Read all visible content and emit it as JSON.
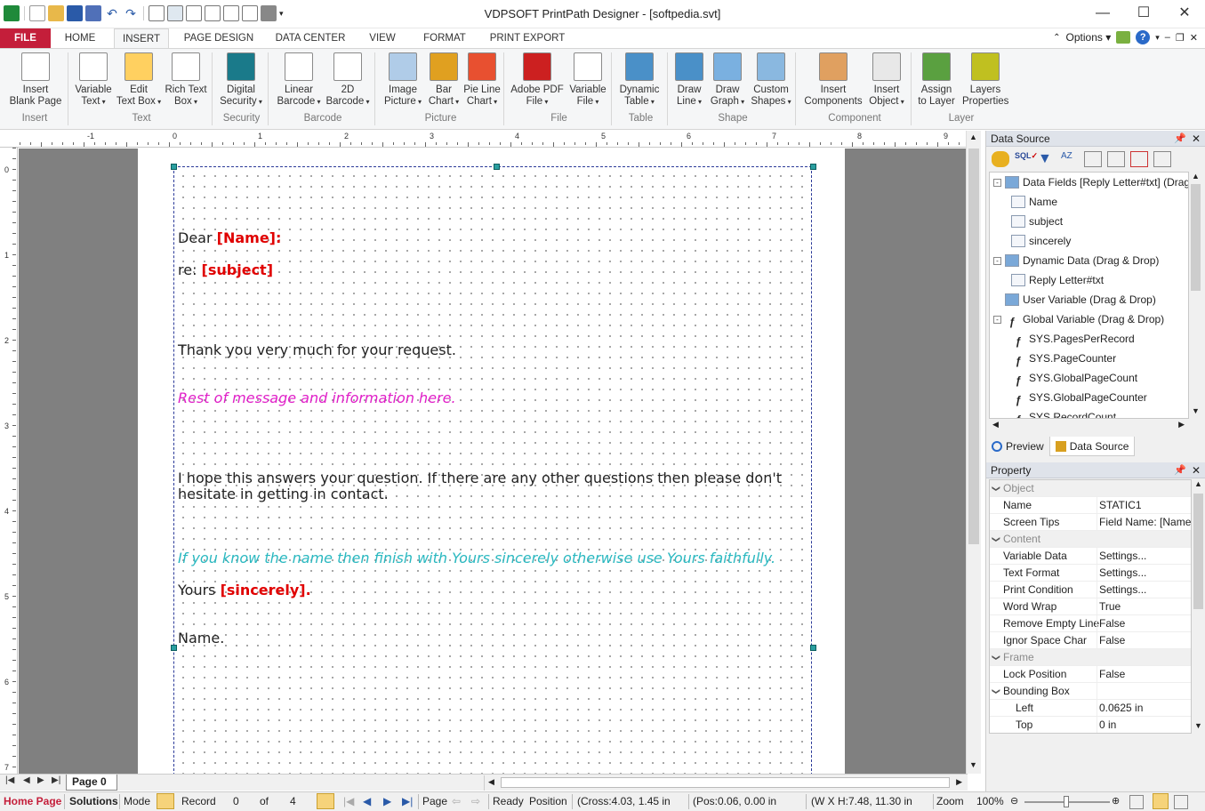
{
  "window": {
    "title": "VDPSOFT PrintPath Designer - [softpedia.svt]"
  },
  "tabs": [
    "FILE",
    "HOME",
    "INSERT",
    "PAGE DESIGN",
    "DATA CENTER",
    "VIEW",
    "FORMAT",
    "PRINT EXPORT"
  ],
  "options_label": "Options",
  "ribbon": {
    "buttons": [
      {
        "l1": "Insert",
        "l2": "Blank Page",
        "icon": "blank-page-icon"
      },
      {
        "l1": "Variable",
        "l2": "Text",
        "icon": "variable-text-icon"
      },
      {
        "l1": "Edit",
        "l2": "Text Box",
        "icon": "edit-textbox-icon"
      },
      {
        "l1": "Rich Text",
        "l2": "Box",
        "icon": "rich-text-icon"
      },
      {
        "l1": "Digital",
        "l2": "Security",
        "icon": "shield-icon"
      },
      {
        "l1": "Linear",
        "l2": "Barcode",
        "icon": "barcode-icon"
      },
      {
        "l1": "2D",
        "l2": "Barcode",
        "icon": "qr-code-icon"
      },
      {
        "l1": "Image",
        "l2": "Picture",
        "icon": "image-icon"
      },
      {
        "l1": "Bar",
        "l2": "Chart",
        "icon": "bar-chart-icon"
      },
      {
        "l1": "Pie Line",
        "l2": "Chart",
        "icon": "pie-chart-icon"
      },
      {
        "l1": "Adobe PDF",
        "l2": "File",
        "icon": "pdf-icon"
      },
      {
        "l1": "Variable",
        "l2": "File",
        "icon": "variable-file-icon"
      },
      {
        "l1": "Dynamic",
        "l2": "Table",
        "icon": "table-icon"
      },
      {
        "l1": "Draw",
        "l2": "Line",
        "icon": "line-icon"
      },
      {
        "l1": "Draw",
        "l2": "Graph",
        "icon": "rectangle-icon"
      },
      {
        "l1": "Custom",
        "l2": "Shapes",
        "icon": "shapes-icon"
      },
      {
        "l1": "Insert",
        "l2": "Components",
        "icon": "components-icon"
      },
      {
        "l1": "Insert",
        "l2": "Object",
        "icon": "object-icon"
      },
      {
        "l1": "Assign",
        "l2": "to Layer",
        "icon": "assign-layer-icon"
      },
      {
        "l1": "Layers",
        "l2": "Properties",
        "icon": "layers-icon"
      }
    ],
    "groups": [
      "Insert",
      "Text",
      "Security",
      "Barcode",
      "Picture",
      "File",
      "Table",
      "Shape",
      "Component",
      "Layer"
    ]
  },
  "ruler": {
    "h_numbers": [
      "-1",
      "0",
      "1",
      "2",
      "3",
      "4",
      "5",
      "6",
      "7",
      "8",
      "9"
    ],
    "v_numbers": [
      "0",
      "1",
      "2",
      "3",
      "4",
      "5",
      "6",
      "7"
    ]
  },
  "document": {
    "line1_prefix": "Dear ",
    "line1_field": "[Name]:",
    "line2_prefix": "re:  ",
    "line2_field": "[subject]",
    "line3": "Thank you very much for your request.",
    "line4": "Rest of message and information here.",
    "line5a": "I hope this answers your question.  If there are any other questions then please don't",
    "line5b": "hesitate in getting in contact.",
    "line6": "If you know the name then finish with Yours sincerely otherwise use Yours faithfully.",
    "line7_prefix": "Yours ",
    "line7_field": "[sincerely].",
    "line8": "Name.",
    "colors": {
      "field": "#e00000",
      "magenta": "#e020c8",
      "cyan": "#2ab8c0"
    }
  },
  "page_tab": "Page 0",
  "data_source": {
    "title": "Data Source",
    "tree": [
      {
        "label": "Data Fields [Reply Letter#txt]  (Drag",
        "level": 0,
        "expand": "-"
      },
      {
        "label": "Name",
        "level": 1
      },
      {
        "label": "subject",
        "level": 1
      },
      {
        "label": "sincerely",
        "level": 1
      },
      {
        "label": "Dynamic Data (Drag & Drop)",
        "level": 0,
        "expand": "-"
      },
      {
        "label": "Reply Letter#txt",
        "level": 1
      },
      {
        "label": "User Variable (Drag & Drop)",
        "level": 0
      },
      {
        "label": "Global Variable (Drag & Drop)",
        "level": 0,
        "expand": "-"
      },
      {
        "label": "SYS.PagesPerRecord",
        "level": 1
      },
      {
        "label": "SYS.PageCounter",
        "level": 1
      },
      {
        "label": "SYS.GlobalPageCount",
        "level": 1
      },
      {
        "label": "SYS.GlobalPageCounter",
        "level": 1
      },
      {
        "label": "SYS.RecordCount",
        "level": 1
      }
    ],
    "bottom_tabs": [
      "Preview",
      "Data Source"
    ]
  },
  "property": {
    "title": "Property",
    "rows": [
      {
        "k": "Object",
        "v": "",
        "cat": true
      },
      {
        "k": "Name",
        "v": "STATIC1"
      },
      {
        "k": "Screen Tips",
        "v": "Field Name: [Name"
      },
      {
        "k": "Content",
        "v": "",
        "cat": true
      },
      {
        "k": "Variable Data",
        "v": "Settings..."
      },
      {
        "k": "Text Format",
        "v": "Settings..."
      },
      {
        "k": "Print Condition",
        "v": "Settings..."
      },
      {
        "k": "Word Wrap",
        "v": "True"
      },
      {
        "k": "Remove Empty Line",
        "v": "False"
      },
      {
        "k": "Ignor Space Char",
        "v": "False"
      },
      {
        "k": "Frame",
        "v": "",
        "cat": true
      },
      {
        "k": "Lock Position",
        "v": "False"
      },
      {
        "k": "Bounding Box",
        "v": "",
        "sub": true
      },
      {
        "k": "Left",
        "v": "0.0625 in",
        "indent": true
      },
      {
        "k": "Top",
        "v": "0 in",
        "indent": true
      }
    ]
  },
  "status": {
    "home_page": "Home Page",
    "solutions": "Solutions",
    "mode": "Mode",
    "record": "Record",
    "record_value": "0",
    "of": "of",
    "record_total": "4",
    "page": "Page",
    "ready": "Ready",
    "position": "Position",
    "cross": "(Cross:4.03, 1.45 in",
    "pos": "(Pos:0.06, 0.00 in",
    "wxh": "(W X H:7.48, 11.30 in",
    "zoom": "Zoom",
    "zoom_value": "100%"
  }
}
